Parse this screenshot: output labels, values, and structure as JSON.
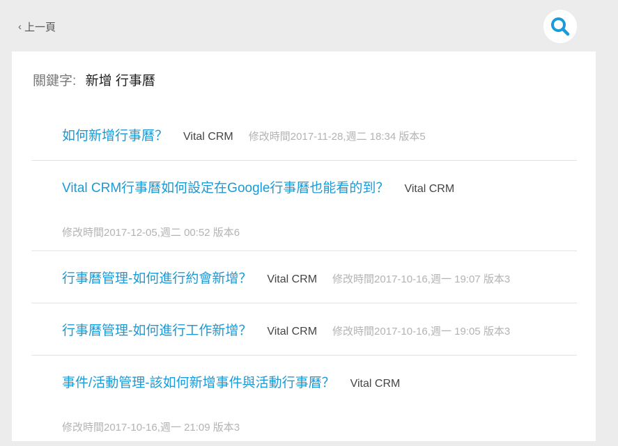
{
  "header": {
    "back_label": "上一頁",
    "search_icon": "search-icon"
  },
  "keyword": {
    "label": "關鍵字:",
    "value": "新增 行事曆"
  },
  "results": [
    {
      "title": "如何新增行事曆？",
      "space": "Vital CRM",
      "meta": "修改時間2017-11-28,週二 18:34 版本5"
    },
    {
      "title": "Vital CRM行事曆如何設定在Google行事曆也能看的到？",
      "space": "Vital CRM",
      "meta": "修改時間2017-12-05,週二 00:52 版本6"
    },
    {
      "title": "行事曆管理-如何進行約會新增？",
      "space": "Vital CRM",
      "meta": "修改時間2017-10-16,週一 19:07 版本3"
    },
    {
      "title": "行事曆管理-如何進行工作新增？",
      "space": "Vital CRM",
      "meta": "修改時間2017-10-16,週一 19:05 版本3"
    },
    {
      "title": "事件/活動管理-該如何新增事件與活動行事曆？",
      "space": "Vital CRM",
      "meta": "修改時間2017-10-16,週一 21:09 版本3"
    }
  ],
  "colors": {
    "accent": "#1a9ad6",
    "background": "#ececec",
    "meta_text": "#b3b3b3"
  }
}
